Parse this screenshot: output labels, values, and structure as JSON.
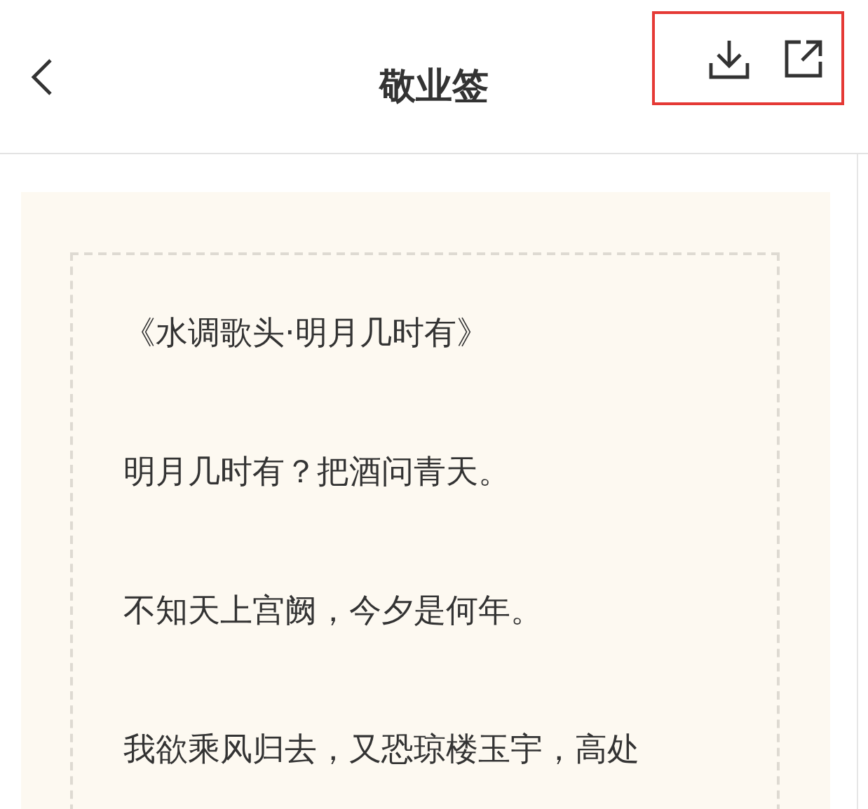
{
  "header": {
    "title": "敬业签",
    "highlighted_actions": true
  },
  "note": {
    "paragraphs": [
      "《水调歌头·明月几时有》",
      "明月几时有？把酒问青天。",
      "不知天上宫阙，今夕是何年。",
      "我欲乘风归去，又恐琼楼玉宇，高处"
    ]
  }
}
